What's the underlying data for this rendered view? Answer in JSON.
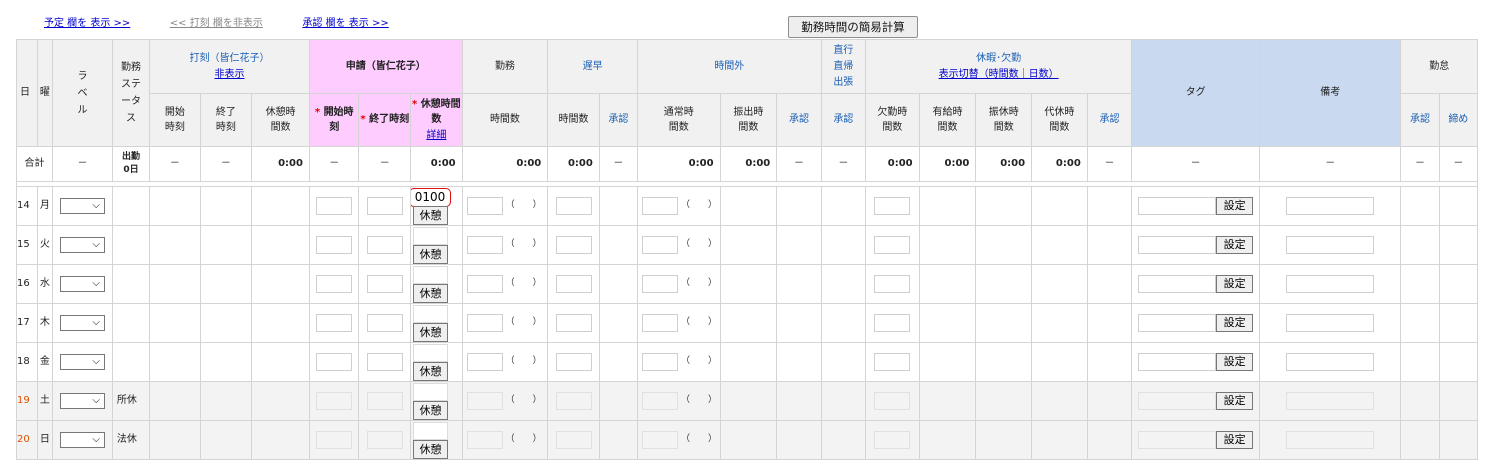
{
  "links": {
    "show_plan": "予定 欄を 表示 >>",
    "hide_stamp": "<< 打刻 欄を非表示",
    "show_approval": "承認 欄を 表示 >>"
  },
  "calc_button": "勤務時間の簡易計算",
  "header": {
    "day": "日",
    "weekday": "曜",
    "label": "ラベル",
    "work_status": "勤務ステータス",
    "stamp_group": "打刻（皆仁花子）",
    "stamp_hide": "非表示",
    "stamp_start": "開始時刻",
    "stamp_end": "終了時刻",
    "stamp_break": "休憩時間数",
    "request_group": "申請（皆仁花子）",
    "req_start": "開始時刻",
    "req_end": "終了時刻",
    "req_break": "休憩時間数",
    "req_detail": "詳細",
    "work": "勤務",
    "work_hours": "時間数",
    "late_early": "遅早",
    "late_hours": "時間数",
    "late_approve": "承認",
    "overtime": "時間外",
    "ot_normal": "通常時間数",
    "ot_holiday": "振出時間数",
    "ot_approve": "承認",
    "direct": "直行直帰出張",
    "direct_approve": "承認",
    "leave_group": "休暇･欠勤",
    "leave_toggle": "表示切替（時間数｜日数）",
    "absence": "欠勤時間数",
    "paid": "有給時間数",
    "substitute": "振休時間数",
    "compensatory": "代休時間数",
    "leave_approve": "承認",
    "tag": "タグ",
    "note": "備考",
    "attendance": "勤怠",
    "att_approve": "承認",
    "att_close": "締め"
  },
  "totals": {
    "label": "合計",
    "dash": "－",
    "work_days_label": "出勤",
    "work_days_value": "0日",
    "time_zero": "0:00"
  },
  "rows": [
    {
      "day": "14",
      "weekday": "月",
      "status": "",
      "weekend": false,
      "break_value": "0100"
    },
    {
      "day": "15",
      "weekday": "火",
      "status": "",
      "weekend": false
    },
    {
      "day": "16",
      "weekday": "水",
      "status": "",
      "weekend": false
    },
    {
      "day": "17",
      "weekday": "木",
      "status": "",
      "weekend": false
    },
    {
      "day": "18",
      "weekday": "金",
      "status": "",
      "weekend": false
    },
    {
      "day": "19",
      "weekday": "土",
      "status": "所休",
      "weekend": true
    },
    {
      "day": "20",
      "weekday": "日",
      "status": "法休",
      "weekend": true
    }
  ],
  "row_labels": {
    "break_button": "休憩",
    "set_button": "設定",
    "paren_open": "（",
    "paren_close": "）"
  },
  "colors": {
    "link_blue": "#0000cc",
    "request_header": "#ffccff",
    "tag_note_header": "#c9d9ef",
    "weekend_day": "#e05000",
    "highlight": "#e01010"
  },
  "icons": {
    "label_dropdown": "chevron-down-icon"
  }
}
